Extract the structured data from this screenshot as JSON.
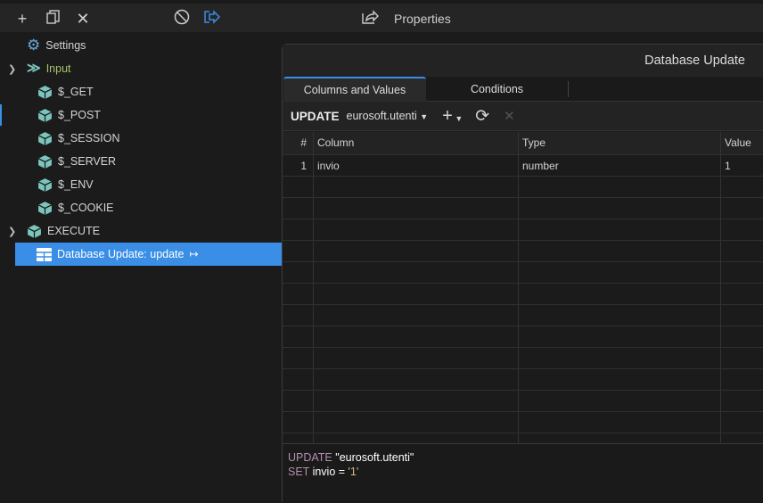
{
  "toolbar": {
    "icons": [
      "plus-icon",
      "copy-icon",
      "close-icon",
      "disable-icon",
      "exit-icon",
      "share-icon"
    ],
    "properties_label": "Properties"
  },
  "tree": {
    "settings": "Settings",
    "input": "Input",
    "input_items": [
      "$_GET",
      "$_POST",
      "$_SESSION",
      "$_SERVER",
      "$_ENV",
      "$_COOKIE"
    ],
    "execute": "EXECUTE",
    "selected": "Database Update: update"
  },
  "colors": {
    "accent": "#3a8ee6",
    "input_label": "#a5c26b",
    "cube": "#7cc5bc"
  },
  "dialog": {
    "title": "Database Update",
    "tabs": [
      {
        "label": "Columns and Values",
        "active": true
      },
      {
        "label": "Conditions",
        "active": false
      }
    ],
    "update_label": "UPDATE",
    "table_name": "eurosoft.utenti",
    "columns": [
      "#",
      "Column",
      "Type",
      "Value"
    ],
    "rows": [
      {
        "n": "1",
        "column": "invio",
        "type": "number",
        "value": "1"
      }
    ],
    "sql": {
      "l1_kw": "UPDATE",
      "l1_str": "\"eurosoft.utenti\"",
      "l2_kw": "SET",
      "l2_mid": "invio = ",
      "l2_val": "'1'"
    }
  }
}
